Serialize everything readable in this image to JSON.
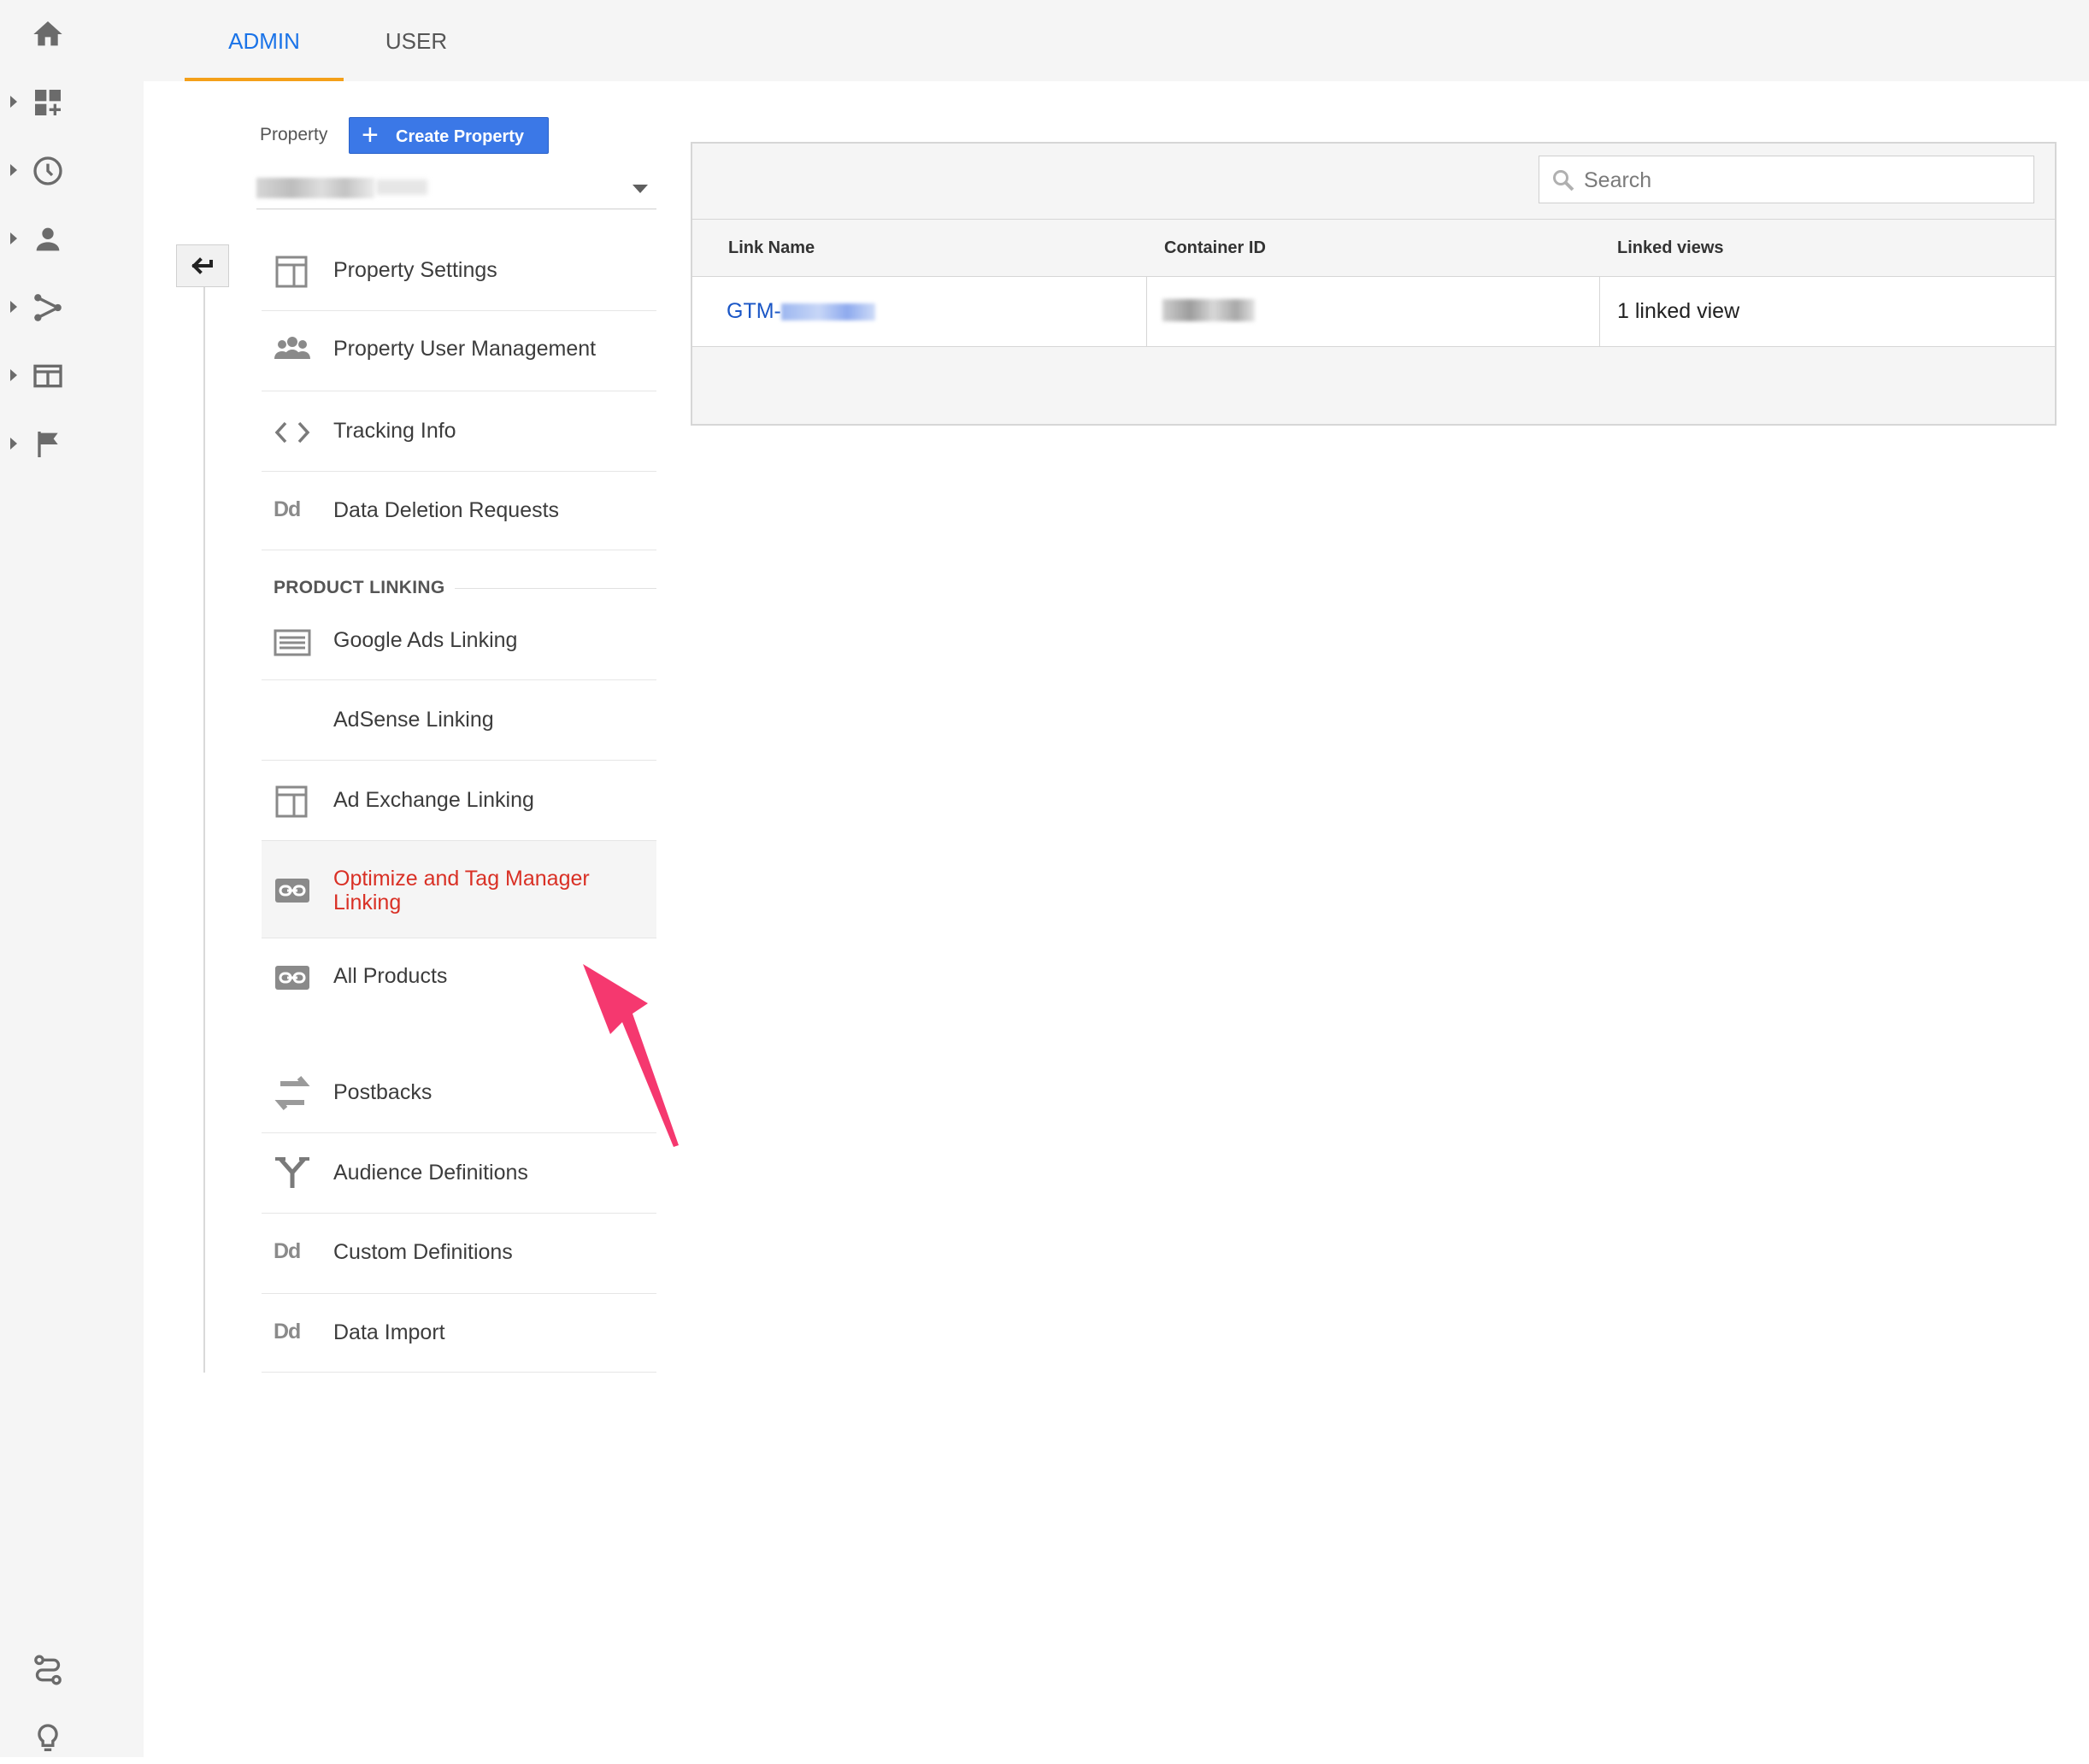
{
  "tabs": {
    "admin": "ADMIN",
    "user": "USER"
  },
  "property": {
    "label": "Property",
    "create_button": "Create Property"
  },
  "menu": {
    "items": [
      {
        "label": "Property Settings",
        "icon": "window-icon"
      },
      {
        "label": "Property User Management",
        "icon": "people-icon"
      },
      {
        "label": "Tracking Info",
        "icon": "code-brackets-icon"
      },
      {
        "label": "Data Deletion Requests",
        "icon": "dd-icon"
      }
    ],
    "section": "PRODUCT LINKING",
    "linking": [
      {
        "label": "Google Ads Linking",
        "icon": "ads-icon"
      },
      {
        "label": "AdSense Linking",
        "icon": ""
      },
      {
        "label": "Ad Exchange Linking",
        "icon": "window-icon"
      },
      {
        "label": "Optimize and Tag Manager Linking",
        "icon": "link-icon",
        "active": true
      },
      {
        "label": "All Products",
        "icon": "link-icon"
      }
    ],
    "more": [
      {
        "label": "Postbacks",
        "icon": "postback-icon"
      },
      {
        "label": "Audience Definitions",
        "icon": "fork-icon"
      },
      {
        "label": "Custom Definitions",
        "icon": "dd-icon"
      },
      {
        "label": "Data Import",
        "icon": "dd-icon"
      }
    ]
  },
  "table": {
    "search_placeholder": "Search",
    "columns": [
      "Link Name",
      "Container ID",
      "Linked views"
    ],
    "rows": [
      {
        "link_name": "GTM-",
        "linked_views": "1 linked view"
      }
    ]
  },
  "colors": {
    "accent": "#1a73e8",
    "tab_underline": "#f4a019",
    "active": "#d93025",
    "annotation_arrow": "#f5386f"
  }
}
